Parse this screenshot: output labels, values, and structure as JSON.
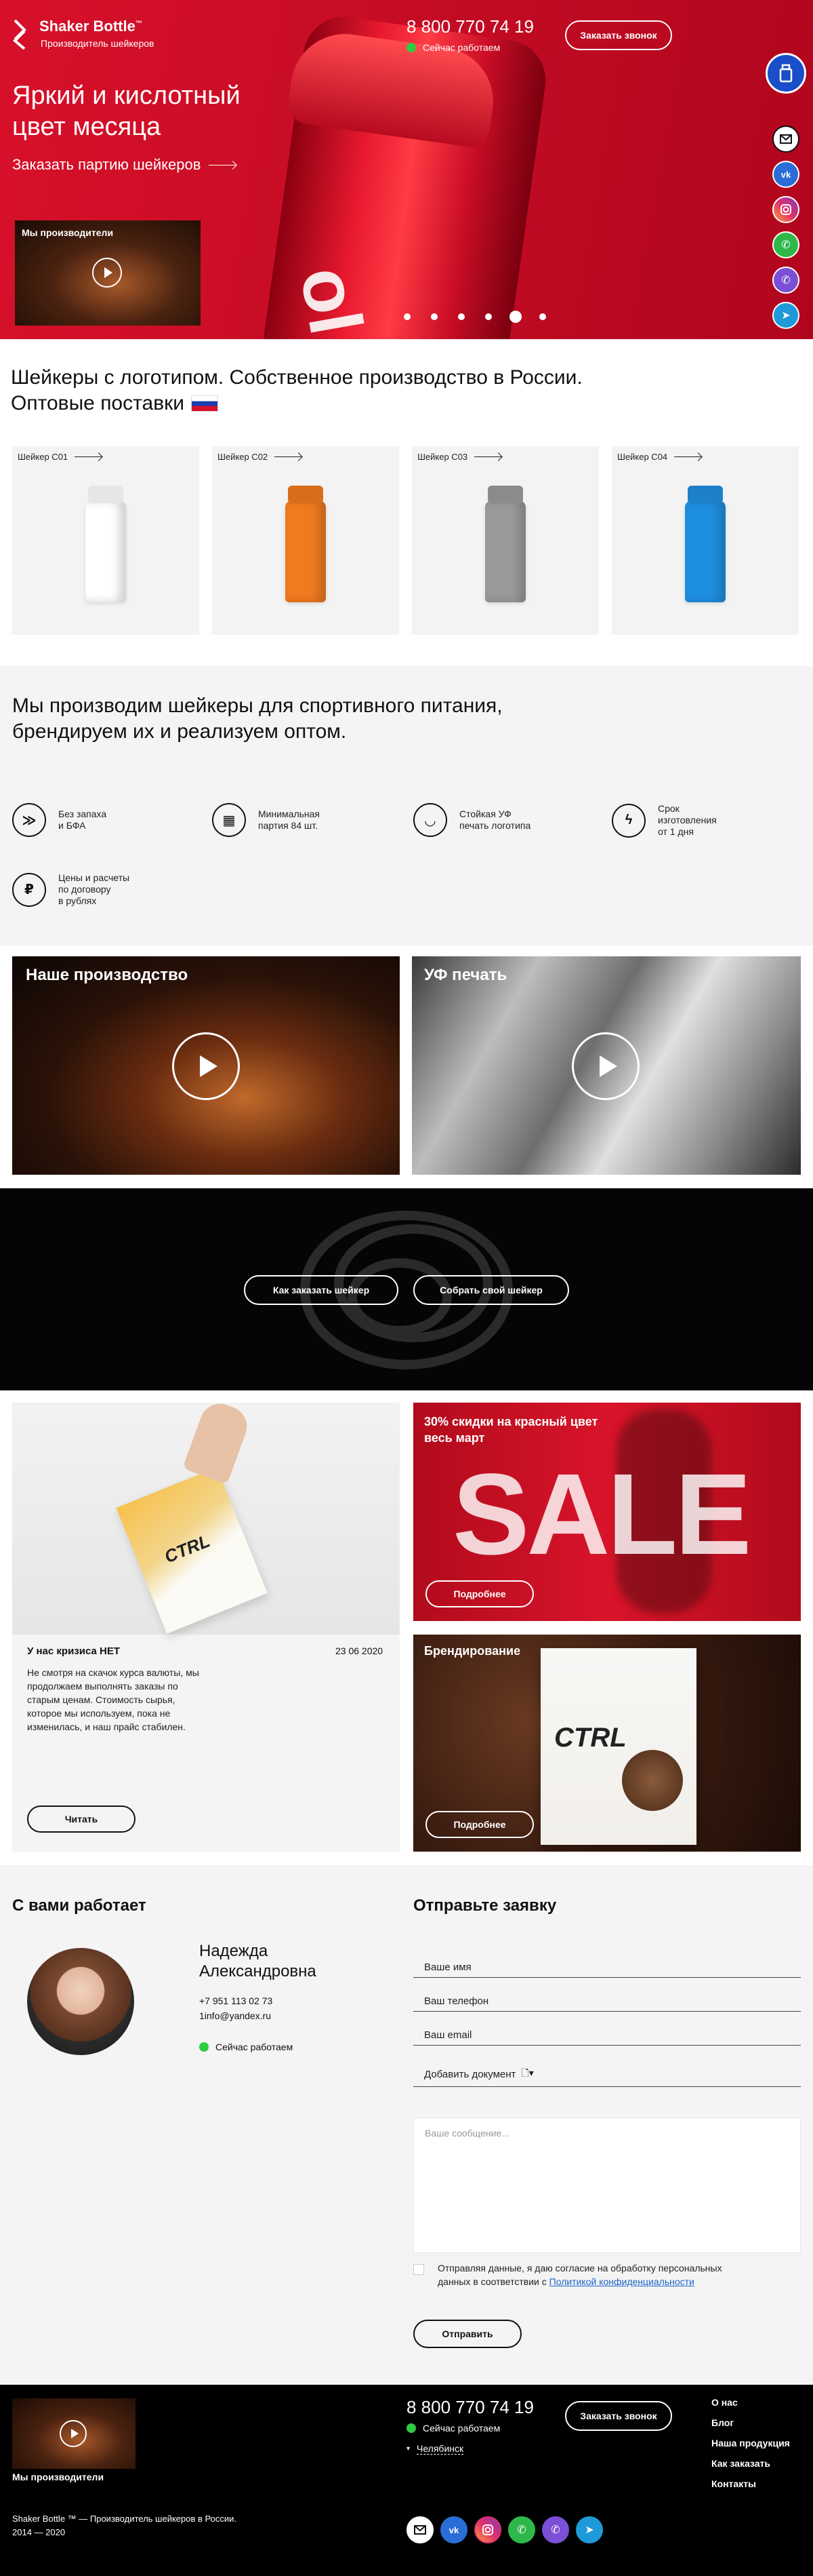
{
  "header": {
    "logo_title": "Shaker Bottle",
    "logo_tm": "™",
    "logo_subtitle": "Производитель шейкеров",
    "phone": "8 800 770 74 19",
    "status": "Сейчас работаем",
    "callback_button": "Заказать звонок"
  },
  "hero": {
    "title_line1": "Яркий и кислотный",
    "title_line2": "цвет месяца",
    "cta": "Заказать партию шейкеров",
    "video_label": "Мы производители",
    "slides_count": 6,
    "active_slide": 5,
    "cup_text": "Shaker Bottle"
  },
  "social": [
    "mail-icon",
    "vk-icon",
    "instagram-icon",
    "phone-icon",
    "viber-icon",
    "telegram-icon"
  ],
  "intro": {
    "line1": "Шейкеры с логотипом. Собственное производство в России.",
    "line2": "Оптовые поставки"
  },
  "products": [
    {
      "label": "Шейкер C01",
      "color": "#ffffff"
    },
    {
      "label": "Шейкер C02",
      "color": "#f07a1f"
    },
    {
      "label": "Шейкер C03",
      "color": "#9a9a9a"
    },
    {
      "label": "Шейкер C04",
      "color": "#1f8fe0"
    }
  ],
  "about": {
    "line1": "Мы производим шейкеры для спортивного питания,",
    "line2": "брендируем их и реализуем оптом."
  },
  "features": [
    {
      "icon": "no-smell-icon",
      "glyph": "≫",
      "text": "Без запаха\nи БФА"
    },
    {
      "icon": "batch-icon",
      "glyph": "▦",
      "text": "Минимальная\nпартия 84 шт."
    },
    {
      "icon": "shield-icon",
      "glyph": "◡",
      "text": "Стойкая УФ\nпечать логотипа"
    },
    {
      "icon": "lightning-icon",
      "glyph": "ϟ",
      "text": "Срок\nизготовления\nот 1 дня"
    },
    {
      "icon": "ruble-icon",
      "glyph": "₽",
      "text": "Цены и расчеты\nпо договору\nв рублях"
    }
  ],
  "videos": {
    "production": "Наше производство",
    "uv": "УФ печать"
  },
  "dark_band": {
    "how_to_order": "Как заказать шейкер",
    "build_shaker": "Собрать свой шейкер"
  },
  "news": {
    "title": "У нас кризиса НЕТ",
    "date": "23 06 2020",
    "text": "Не смотря на скачок курса валюты, мы продолжаем выполнять заказы по старым ценам. Стоимость сырья, которое мы используем, пока не изменилась, и наш прайс стабилен.",
    "read": "Читать",
    "package_brand": "CTRL"
  },
  "promo": {
    "sale_text": "30% скидки на красный цвет весь март",
    "sale_word": "SALE",
    "more": "Подробнее"
  },
  "branding": {
    "title": "Брендирование",
    "brand": "CTRL",
    "more": "Подробнее"
  },
  "contact": {
    "heading": "С вами работает",
    "name_line1": "Надежда",
    "name_line2": "Александровна",
    "phone": "+7 951 113 02 73",
    "email": "1info@yandex.ru",
    "status": "Сейчас работаем"
  },
  "form": {
    "heading": "Отправьте заявку",
    "name": "Ваше имя",
    "phone": "Ваш телефон",
    "email": "Ваш email",
    "attach": "Добавить документ",
    "message": "Ваше сообщение...",
    "consent_pre": "Отправляя данные, я даю согласие на обработку персональных данных в соответствии с ",
    "consent_link": "Политикой конфиденциальности",
    "submit": "Отправить"
  },
  "footer": {
    "video_label": "Мы производители",
    "phone": "8 800 770 74 19",
    "status": "Сейчас работаем",
    "city": "Челябинск",
    "callback": "Заказать звонок",
    "links": [
      "О нас",
      "Блог",
      "Наша продукция",
      "Как заказать",
      "Контакты"
    ],
    "copyright_line1": "Shaker Bottle ™ — Производитель шейкеров в России.",
    "copyright_line2": "2014 — 2020"
  },
  "colors": {
    "brand_red": "#d4102a",
    "accent_blue": "#1a4ec9",
    "status_green": "#2ecc40"
  }
}
